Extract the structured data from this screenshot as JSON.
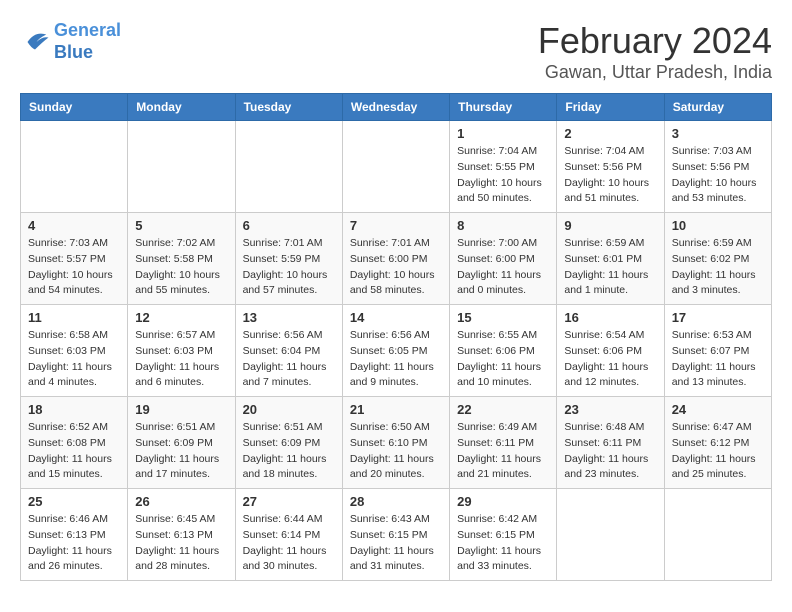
{
  "logo": {
    "text_general": "General",
    "text_blue": "Blue"
  },
  "title": "February 2024",
  "subtitle": "Gawan, Uttar Pradesh, India",
  "days_of_week": [
    "Sunday",
    "Monday",
    "Tuesday",
    "Wednesday",
    "Thursday",
    "Friday",
    "Saturday"
  ],
  "weeks": [
    [
      {
        "day": "",
        "info": ""
      },
      {
        "day": "",
        "info": ""
      },
      {
        "day": "",
        "info": ""
      },
      {
        "day": "",
        "info": ""
      },
      {
        "day": "1",
        "info": "Sunrise: 7:04 AM\nSunset: 5:55 PM\nDaylight: 10 hours\nand 50 minutes."
      },
      {
        "day": "2",
        "info": "Sunrise: 7:04 AM\nSunset: 5:56 PM\nDaylight: 10 hours\nand 51 minutes."
      },
      {
        "day": "3",
        "info": "Sunrise: 7:03 AM\nSunset: 5:56 PM\nDaylight: 10 hours\nand 53 minutes."
      }
    ],
    [
      {
        "day": "4",
        "info": "Sunrise: 7:03 AM\nSunset: 5:57 PM\nDaylight: 10 hours\nand 54 minutes."
      },
      {
        "day": "5",
        "info": "Sunrise: 7:02 AM\nSunset: 5:58 PM\nDaylight: 10 hours\nand 55 minutes."
      },
      {
        "day": "6",
        "info": "Sunrise: 7:01 AM\nSunset: 5:59 PM\nDaylight: 10 hours\nand 57 minutes."
      },
      {
        "day": "7",
        "info": "Sunrise: 7:01 AM\nSunset: 6:00 PM\nDaylight: 10 hours\nand 58 minutes."
      },
      {
        "day": "8",
        "info": "Sunrise: 7:00 AM\nSunset: 6:00 PM\nDaylight: 11 hours\nand 0 minutes."
      },
      {
        "day": "9",
        "info": "Sunrise: 6:59 AM\nSunset: 6:01 PM\nDaylight: 11 hours\nand 1 minute."
      },
      {
        "day": "10",
        "info": "Sunrise: 6:59 AM\nSunset: 6:02 PM\nDaylight: 11 hours\nand 3 minutes."
      }
    ],
    [
      {
        "day": "11",
        "info": "Sunrise: 6:58 AM\nSunset: 6:03 PM\nDaylight: 11 hours\nand 4 minutes."
      },
      {
        "day": "12",
        "info": "Sunrise: 6:57 AM\nSunset: 6:03 PM\nDaylight: 11 hours\nand 6 minutes."
      },
      {
        "day": "13",
        "info": "Sunrise: 6:56 AM\nSunset: 6:04 PM\nDaylight: 11 hours\nand 7 minutes."
      },
      {
        "day": "14",
        "info": "Sunrise: 6:56 AM\nSunset: 6:05 PM\nDaylight: 11 hours\nand 9 minutes."
      },
      {
        "day": "15",
        "info": "Sunrise: 6:55 AM\nSunset: 6:06 PM\nDaylight: 11 hours\nand 10 minutes."
      },
      {
        "day": "16",
        "info": "Sunrise: 6:54 AM\nSunset: 6:06 PM\nDaylight: 11 hours\nand 12 minutes."
      },
      {
        "day": "17",
        "info": "Sunrise: 6:53 AM\nSunset: 6:07 PM\nDaylight: 11 hours\nand 13 minutes."
      }
    ],
    [
      {
        "day": "18",
        "info": "Sunrise: 6:52 AM\nSunset: 6:08 PM\nDaylight: 11 hours\nand 15 minutes."
      },
      {
        "day": "19",
        "info": "Sunrise: 6:51 AM\nSunset: 6:09 PM\nDaylight: 11 hours\nand 17 minutes."
      },
      {
        "day": "20",
        "info": "Sunrise: 6:51 AM\nSunset: 6:09 PM\nDaylight: 11 hours\nand 18 minutes."
      },
      {
        "day": "21",
        "info": "Sunrise: 6:50 AM\nSunset: 6:10 PM\nDaylight: 11 hours\nand 20 minutes."
      },
      {
        "day": "22",
        "info": "Sunrise: 6:49 AM\nSunset: 6:11 PM\nDaylight: 11 hours\nand 21 minutes."
      },
      {
        "day": "23",
        "info": "Sunrise: 6:48 AM\nSunset: 6:11 PM\nDaylight: 11 hours\nand 23 minutes."
      },
      {
        "day": "24",
        "info": "Sunrise: 6:47 AM\nSunset: 6:12 PM\nDaylight: 11 hours\nand 25 minutes."
      }
    ],
    [
      {
        "day": "25",
        "info": "Sunrise: 6:46 AM\nSunset: 6:13 PM\nDaylight: 11 hours\nand 26 minutes."
      },
      {
        "day": "26",
        "info": "Sunrise: 6:45 AM\nSunset: 6:13 PM\nDaylight: 11 hours\nand 28 minutes."
      },
      {
        "day": "27",
        "info": "Sunrise: 6:44 AM\nSunset: 6:14 PM\nDaylight: 11 hours\nand 30 minutes."
      },
      {
        "day": "28",
        "info": "Sunrise: 6:43 AM\nSunset: 6:15 PM\nDaylight: 11 hours\nand 31 minutes."
      },
      {
        "day": "29",
        "info": "Sunrise: 6:42 AM\nSunset: 6:15 PM\nDaylight: 11 hours\nand 33 minutes."
      },
      {
        "day": "",
        "info": ""
      },
      {
        "day": "",
        "info": ""
      }
    ]
  ]
}
